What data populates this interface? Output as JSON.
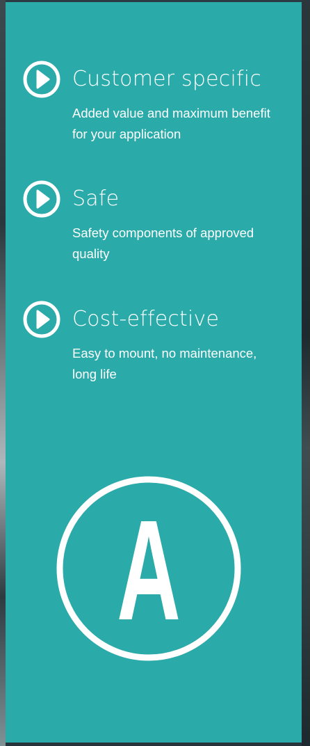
{
  "features": [
    {
      "title": "Customer specific",
      "description": "Added value and maximum benefit for your application",
      "icon": "play-circle-icon"
    },
    {
      "title": "Safe",
      "description": "Safety components of approved quality",
      "icon": "play-circle-icon"
    },
    {
      "title": "Cost-effective",
      "description": "Easy to mount, no maintenance, long life",
      "icon": "play-circle-icon"
    }
  ],
  "badge": {
    "letter": "A",
    "icon": "letter-a-circle-icon"
  },
  "colors": {
    "panel": "#2aaaa9",
    "text": "#ffffff"
  }
}
